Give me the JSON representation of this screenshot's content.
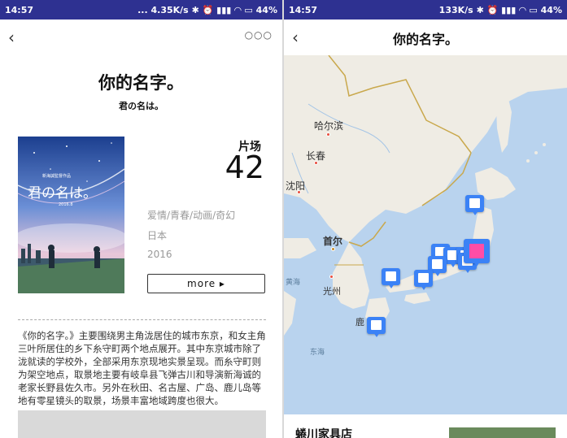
{
  "status_left": {
    "time": "14:57",
    "network": "... 4.35K/s",
    "battery": "44%"
  },
  "status_right": {
    "time": "14:57",
    "network": "133K/s",
    "battery": "44%"
  },
  "detail": {
    "back_icon": "chevron-left-icon",
    "more_icon": "more-dots-icon",
    "title": "你的名字。",
    "subtitle": "君の名は。",
    "count_label": "片场",
    "count_value": "42",
    "genres": "爱情/青春/动画/奇幻",
    "country": "日本",
    "year": "2016",
    "more_label": "more ▸",
    "description": "《你的名字。》主要围绕男主角泷居住的城市东京，和女主角三叶所居住的乡下糸守町两个地点展开。其中东京城市除了泷就读的学校外，全部采用东京现地实景呈现。而糸守町则为架空地点，取景地主要有岐阜县飞弹古川和导演新海诚的老家长野县佐久市。另外在秋田、名古屋、广岛、鹿儿岛等地有零星镜头的取景，场景丰富地域跨度也很大。",
    "poster": {
      "title": "君の名は。",
      "tagline": "新海誠監督作品",
      "date": "2016.8"
    }
  },
  "map_screen": {
    "back_icon": "chevron-left-icon",
    "title": "你的名字。",
    "labels": {
      "harbin": "哈尔滨",
      "changchun": "长春",
      "shenyang": "沈阳",
      "seoul": "首尔",
      "gwangju": "光州",
      "yellow_sea": "黄海",
      "east_sea": "东海",
      "kagoshima": "鹿"
    },
    "card_title": "蜷川家具店"
  },
  "colors": {
    "status_bar": "#2e3191",
    "marker": "#3b82f6",
    "marker_active": "#ff4da6",
    "sea": "#b9d3ee",
    "land": "#efece4"
  }
}
